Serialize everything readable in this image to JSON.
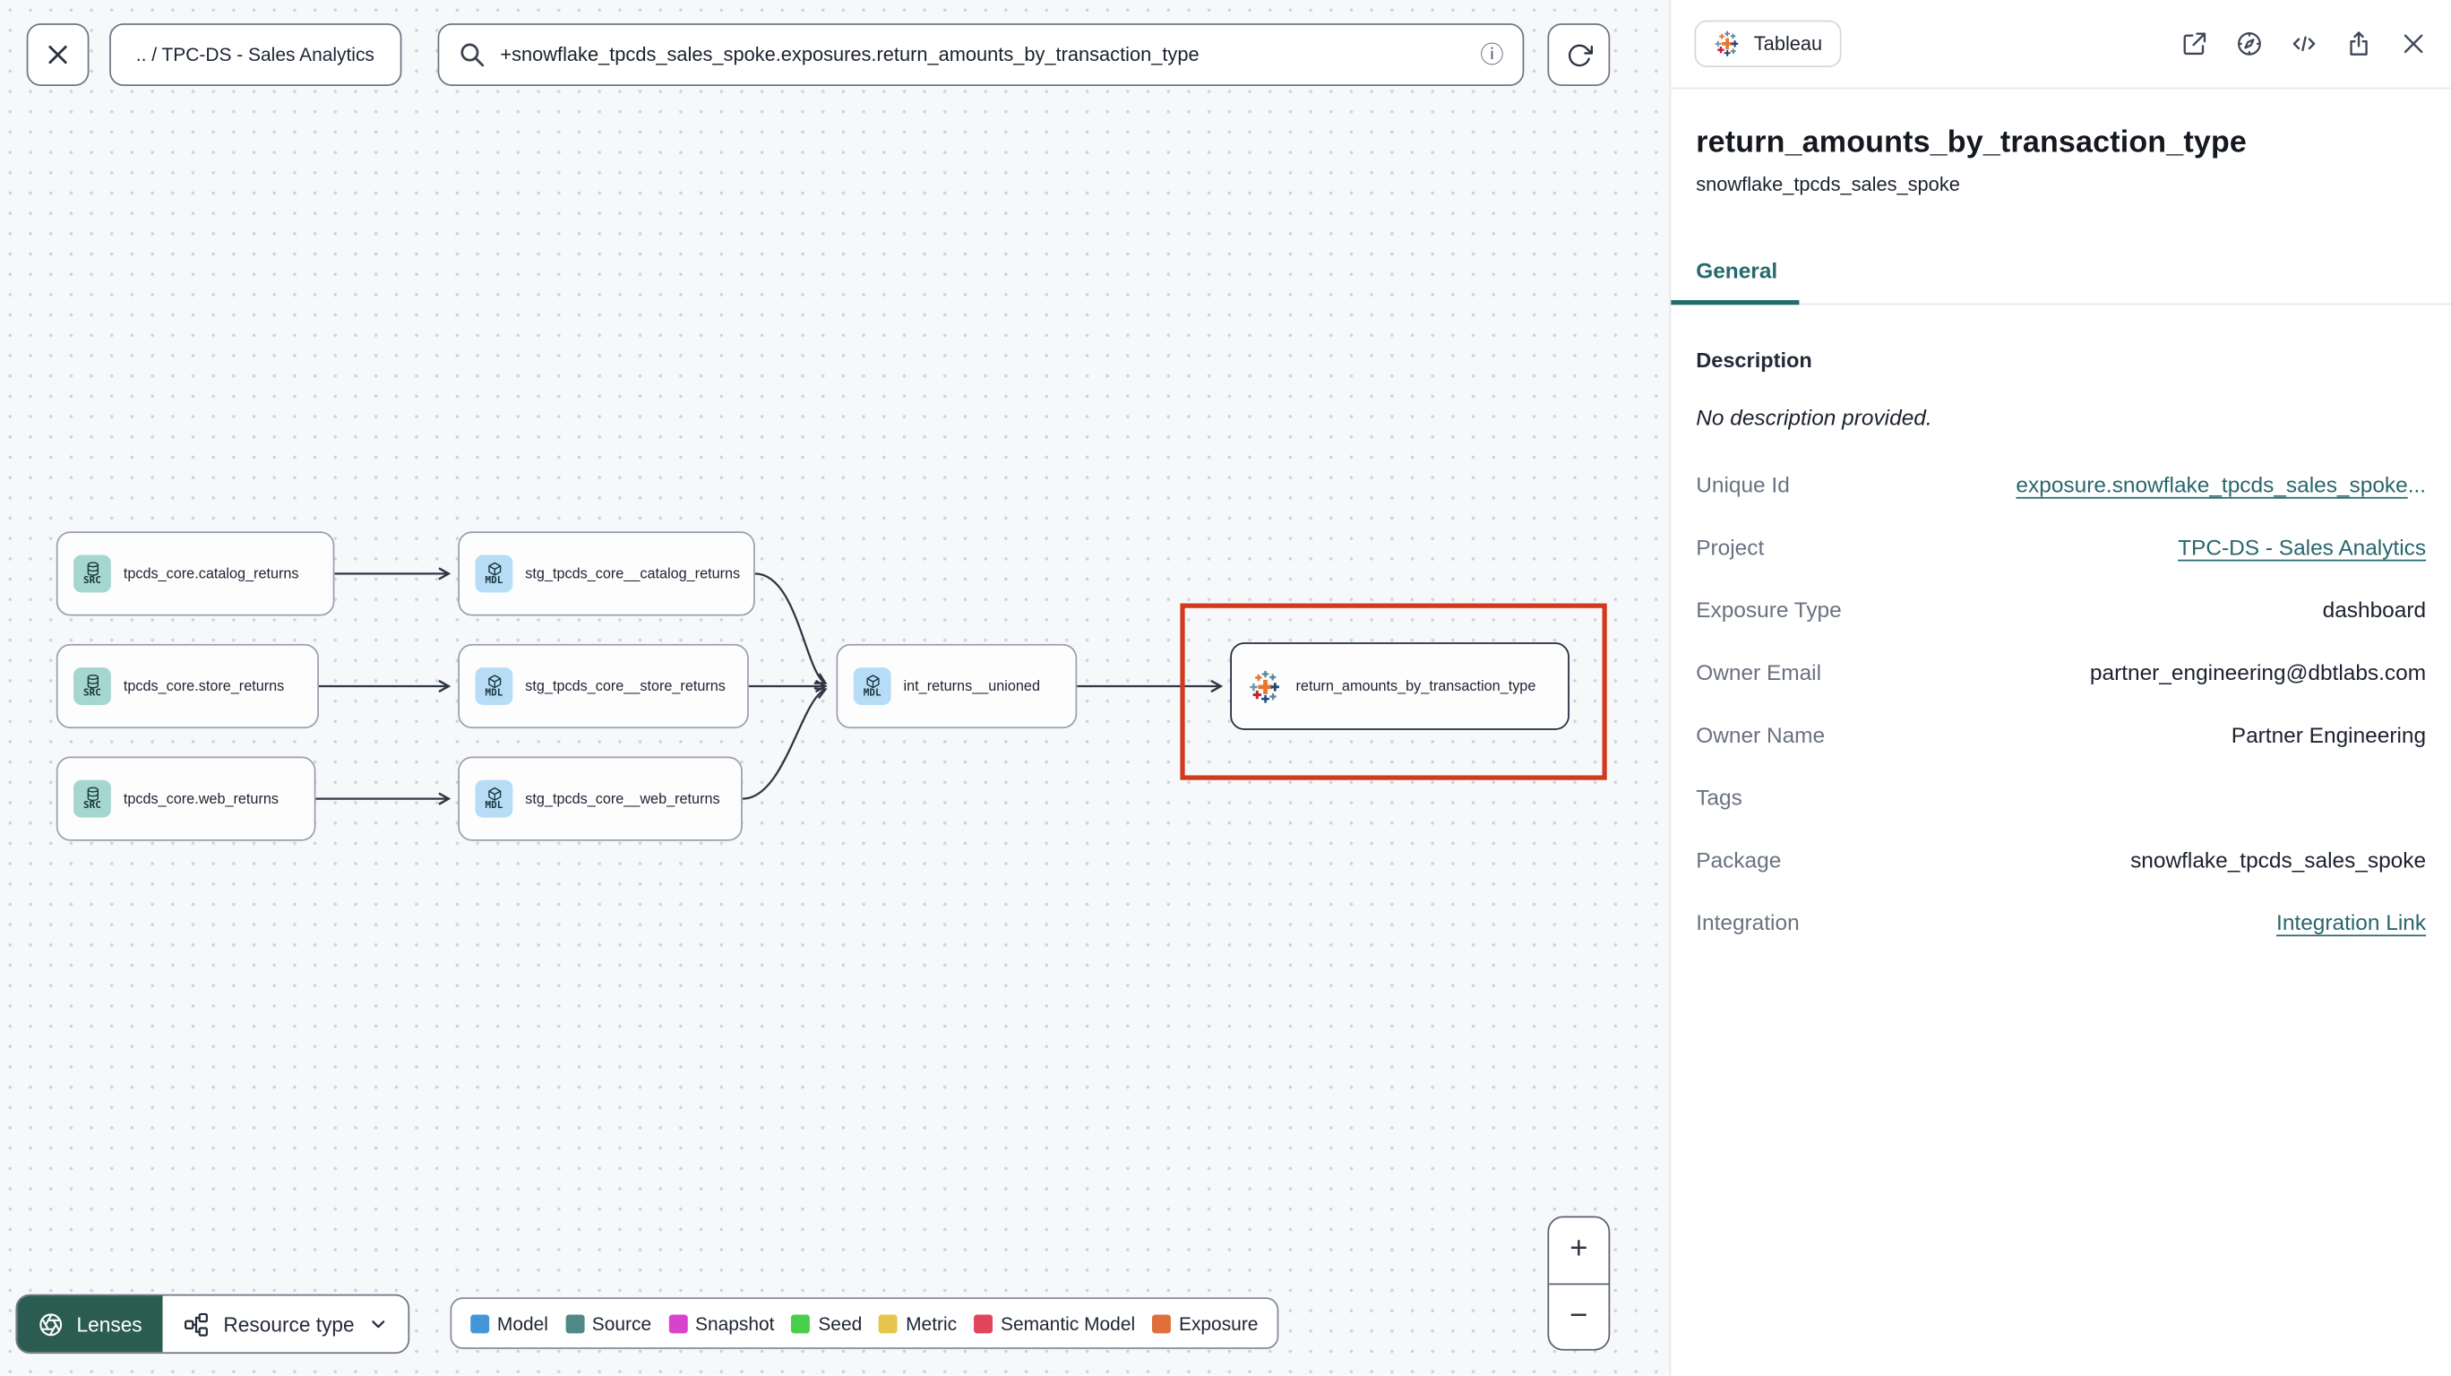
{
  "toolbar": {
    "breadcrumb": ".. / TPC-DS - Sales Analytics",
    "search_value": "+snowflake_tpcds_sales_spoke.exposures.return_amounts_by_transaction_type",
    "info_glyph": "ⓘ"
  },
  "canvas": {
    "nodes": [
      {
        "label": "tpcds_core.catalog_returns",
        "badge": "SRC"
      },
      {
        "label": "tpcds_core.store_returns",
        "badge": "SRC"
      },
      {
        "label": "tpcds_core.web_returns",
        "badge": "SRC"
      },
      {
        "label": "stg_tpcds_core__catalog_returns",
        "badge": "MDL"
      },
      {
        "label": "stg_tpcds_core__store_returns",
        "badge": "MDL"
      },
      {
        "label": "stg_tpcds_core__web_returns",
        "badge": "MDL"
      },
      {
        "label": "int_returns__unioned",
        "badge": "MDL"
      },
      {
        "label": "return_amounts_by_transaction_type",
        "badge": "tableau-logo"
      }
    ],
    "highlight_color": "#d13a1c",
    "zoom_in": "+",
    "zoom_out": "−"
  },
  "footer": {
    "lenses_label": "Lenses",
    "resource_type_label": "Resource type",
    "legend": [
      {
        "label": "Model",
        "color": "#4596d8"
      },
      {
        "label": "Source",
        "color": "#4f8a89"
      },
      {
        "label": "Snapshot",
        "color": "#d943cb"
      },
      {
        "label": "Seed",
        "color": "#49cf49"
      },
      {
        "label": "Metric",
        "color": "#e5c54c"
      },
      {
        "label": "Semantic Model",
        "color": "#e1455a"
      },
      {
        "label": "Exposure",
        "color": "#df703c"
      }
    ]
  },
  "panel": {
    "integration_badge": "Tableau",
    "title": "return_amounts_by_transaction_type",
    "subtitle": "snowflake_tpcds_sales_spoke",
    "tab": "General",
    "description_heading": "Description",
    "description_empty": "No description provided.",
    "fields": [
      {
        "label": "Unique Id",
        "value": "exposure.snowflake_tpcds_sales_spoke",
        "suffix": "...",
        "type": "link"
      },
      {
        "label": "Project",
        "value": "TPC-DS - Sales Analytics",
        "type": "link"
      },
      {
        "label": "Exposure Type",
        "value": "dashboard",
        "type": "text"
      },
      {
        "label": "Owner Email",
        "value": "partner_engineering@dbtlabs.com",
        "type": "text"
      },
      {
        "label": "Owner Name",
        "value": "Partner Engineering",
        "type": "text"
      },
      {
        "label": "Tags",
        "value": "",
        "type": "text"
      },
      {
        "label": "Package",
        "value": "snowflake_tpcds_sales_spoke",
        "type": "text"
      },
      {
        "label": "Integration",
        "value": "Integration Link",
        "type": "link"
      }
    ],
    "icons": [
      "open-in-new-icon",
      "compass-icon",
      "code-icon",
      "share-icon",
      "close-icon"
    ]
  },
  "colors": {
    "accent_teal": "#256a6e",
    "link_teal": "#29666d",
    "lenses_green": "#2b5c50",
    "highlight_red": "#d13a1c",
    "source_badge_bg": "#a5d6d0",
    "model_badge_bg": "#b6dcf6",
    "canvas_bg": "#f7f8fa"
  }
}
